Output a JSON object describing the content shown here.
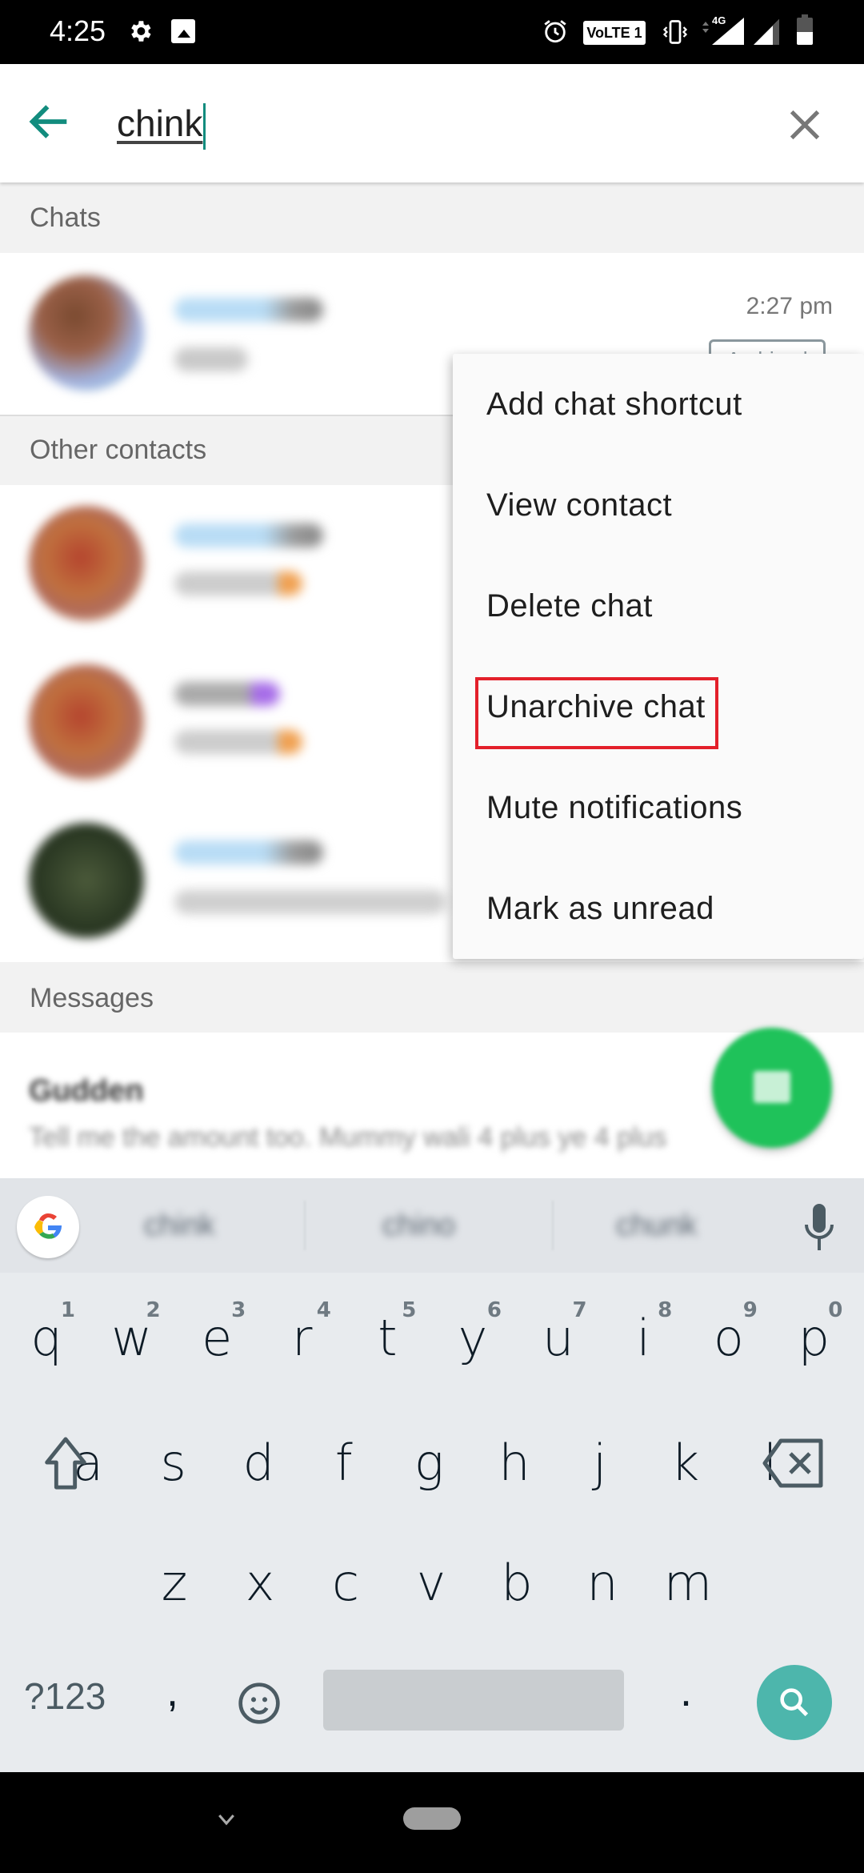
{
  "status_bar": {
    "time": "4:25",
    "left_icons": [
      "gear-icon",
      "image-icon"
    ],
    "right_icons": [
      "alarm-icon",
      "volte-icon",
      "vibrate-icon",
      "signal-4g-icon",
      "signal-icon",
      "battery-icon"
    ],
    "volte_label": "VoLTE 1",
    "network_label": "4G"
  },
  "search": {
    "query": "chink",
    "back_icon": "arrow-left-icon",
    "clear_icon": "close-icon",
    "accent_color": "#128C7E"
  },
  "sections": {
    "chats": "Chats",
    "other_contacts": "Other contacts",
    "messages": "Messages"
  },
  "chats": [
    {
      "name": "Chinku Di (blurred)",
      "preview": "Ok (blurred)",
      "time": "2:27 pm",
      "badge": "Archived"
    }
  ],
  "other_contacts": [
    {
      "name": "Chinku Di (blurred)",
      "status": "My Girls (blurred)"
    },
    {
      "name": "Didu (blurred)",
      "status": "My Girls (blurred)"
    },
    {
      "name": "Chinky di (blurred)",
      "status": "Hai tablet! insan ko (blurred)"
    }
  ],
  "messages": [
    {
      "sender": "Gudden",
      "preview": "Tell me the amount too. Mummy wali 4 plus ye 4 plus"
    }
  ],
  "context_menu": {
    "items": [
      {
        "label": "Add chat shortcut"
      },
      {
        "label": "View contact"
      },
      {
        "label": "Delete chat"
      },
      {
        "label": "Unarchive chat",
        "highlighted": true
      },
      {
        "label": "Mute notifications"
      },
      {
        "label": "Mark as unread"
      }
    ],
    "highlight_color": "#e3202a"
  },
  "fab": {
    "icon": "new-chat-icon",
    "color": "#1fc25a"
  },
  "keyboard": {
    "suggestions": [
      "chink",
      "chino",
      "chunk"
    ],
    "row1": [
      "q",
      "w",
      "e",
      "r",
      "t",
      "y",
      "u",
      "i",
      "o",
      "p"
    ],
    "row1_hints": [
      "1",
      "2",
      "3",
      "4",
      "5",
      "6",
      "7",
      "8",
      "9",
      "0"
    ],
    "row2": [
      "a",
      "s",
      "d",
      "f",
      "g",
      "h",
      "j",
      "k",
      "l"
    ],
    "row3": [
      "z",
      "x",
      "c",
      "v",
      "b",
      "n",
      "m"
    ],
    "symbols_label": "?123",
    "comma": ",",
    "period": ".",
    "action_color": "#4db6ac"
  },
  "nav_bar": {
    "back_icon": "chevron-down-icon",
    "home_icon": "home-pill-icon"
  }
}
